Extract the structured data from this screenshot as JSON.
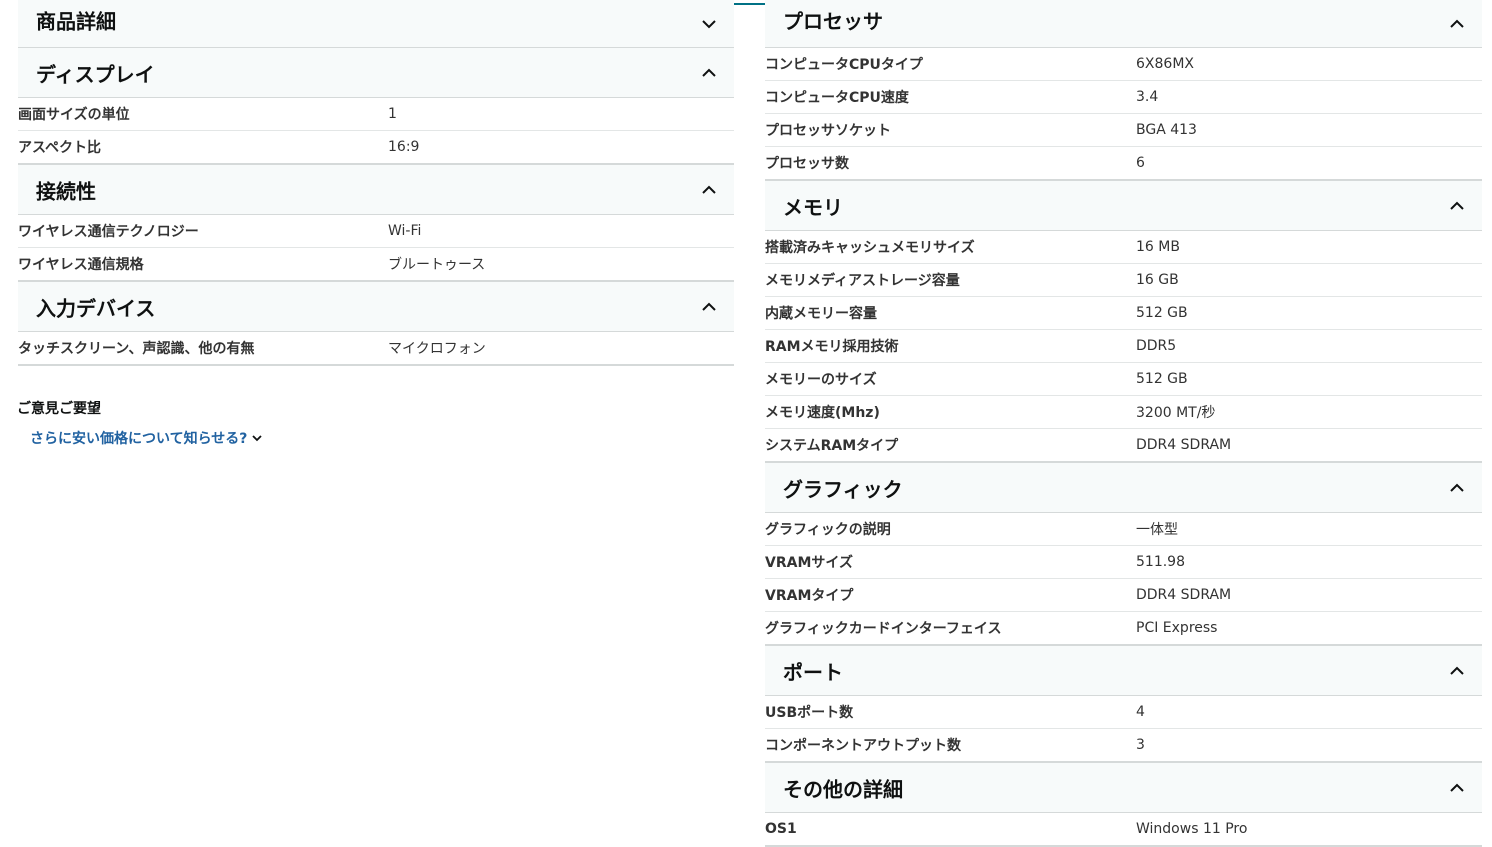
{
  "left": {
    "sections": [
      {
        "title": "商品詳細",
        "expanded": false,
        "rows": []
      },
      {
        "title": "ディスプレイ",
        "expanded": true,
        "rows": [
          {
            "label": "画面サイズの単位",
            "value": "1"
          },
          {
            "label": "アスペクト比",
            "value": "16:9"
          }
        ]
      },
      {
        "title": "接続性",
        "expanded": true,
        "rows": [
          {
            "label": "ワイヤレス通信テクノロジー",
            "value": "Wi-Fi"
          },
          {
            "label": "ワイヤレス通信規格",
            "value": "ブルートゥース"
          }
        ]
      },
      {
        "title": "入力デバイス",
        "expanded": true,
        "rows": [
          {
            "label": "タッチスクリーン、声認識、他の有無",
            "value": "マイクロフォン"
          }
        ]
      }
    ],
    "feedback": {
      "title": "ご意見ご要望",
      "link": "さらに安い価格について知らせる?"
    }
  },
  "right": {
    "sections": [
      {
        "title": "プロセッサ",
        "expanded": true,
        "rows": [
          {
            "label": "コンピュータCPUタイプ",
            "value": "6X86MX"
          },
          {
            "label": "コンピュータCPU速度",
            "value": "3.4"
          },
          {
            "label": "プロセッサソケット",
            "value": "BGA 413"
          },
          {
            "label": "プロセッサ数",
            "value": "6"
          }
        ]
      },
      {
        "title": "メモリ",
        "expanded": true,
        "rows": [
          {
            "label": "搭載済みキャッシュメモリサイズ",
            "value": "16 MB"
          },
          {
            "label": "メモリメディアストレージ容量",
            "value": "16 GB"
          },
          {
            "label": "内蔵メモリー容量",
            "value": "512 GB"
          },
          {
            "label": "RAMメモリ採用技術",
            "value": "DDR5"
          },
          {
            "label": "メモリーのサイズ",
            "value": "512 GB"
          },
          {
            "label": "メモリ速度(Mhz)",
            "value": "3200 MT/秒"
          },
          {
            "label": "システムRAMタイプ",
            "value": "DDR4 SDRAM"
          }
        ]
      },
      {
        "title": "グラフィック",
        "expanded": true,
        "rows": [
          {
            "label": "グラフィックの説明",
            "value": "一体型"
          },
          {
            "label": "VRAMサイズ",
            "value": "511.98"
          },
          {
            "label": "VRAMタイプ",
            "value": "DDR4 SDRAM"
          },
          {
            "label": "グラフィックカードインターフェイス",
            "value": "PCI Express"
          }
        ]
      },
      {
        "title": "ポート",
        "expanded": true,
        "rows": [
          {
            "label": "USBポート数",
            "value": "4"
          },
          {
            "label": "コンポーネントアウトプット数",
            "value": "3"
          }
        ]
      },
      {
        "title": "その他の詳細",
        "expanded": true,
        "rows": [
          {
            "label": "OS1",
            "value": "Windows 11 Pro"
          }
        ]
      }
    ]
  },
  "icons": {
    "expanded": "chevron-up-icon",
    "collapsed": "chevron-down-icon",
    "link_caret": "chevron-down-icon"
  },
  "colors": {
    "header_bg": "#f7fafa",
    "border": "#d5d9d9",
    "link": "#2162a1",
    "accent": "#007185"
  }
}
